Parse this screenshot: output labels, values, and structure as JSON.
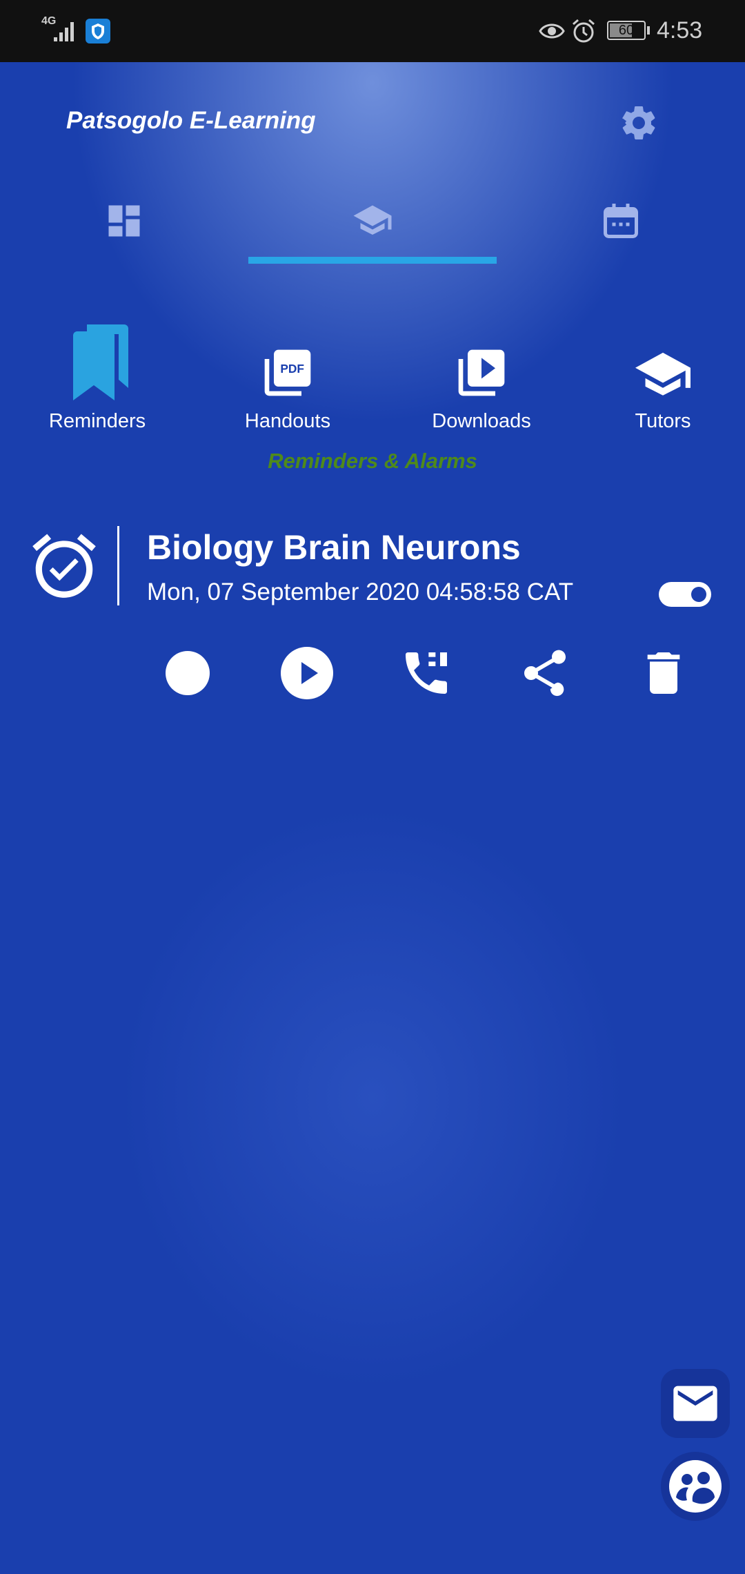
{
  "status_bar": {
    "network": "4G",
    "battery": "60",
    "time": "4:53"
  },
  "app": {
    "title": "Patsogolo E-Learning"
  },
  "tabs": [
    {
      "icon": "dashboard-icon",
      "active": false
    },
    {
      "icon": "graduation-cap-icon",
      "active": true
    },
    {
      "icon": "calendar-icon",
      "active": false
    }
  ],
  "features": [
    {
      "label": "Reminders",
      "icon": "bookmark-icon"
    },
    {
      "label": "Handouts",
      "icon": "pdf-icon"
    },
    {
      "label": "Downloads",
      "icon": "video-library-icon"
    },
    {
      "label": "Tutors",
      "icon": "graduation-cap-icon"
    }
  ],
  "section": {
    "title": "Reminders & Alarms"
  },
  "reminder": {
    "title": "Biology Brain Neurons",
    "datetime": "Mon, 07 September 2020 04:58:58 CAT",
    "enabled": true,
    "actions": [
      "record",
      "play",
      "call",
      "share",
      "delete"
    ]
  },
  "colors": {
    "accent": "#29a6e6",
    "section_title": "#4f8a1a",
    "reminders_icon": "#2aa3e0",
    "background": "#1a3fae"
  }
}
